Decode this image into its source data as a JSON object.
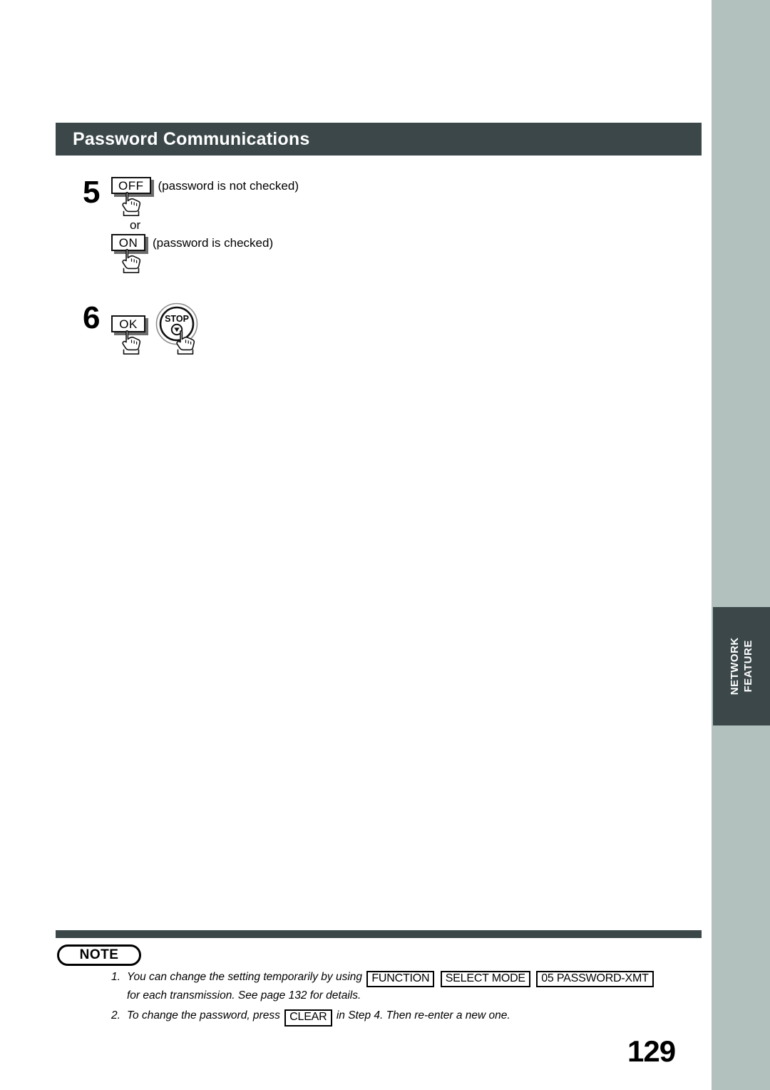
{
  "page": {
    "number": "129",
    "section_tab": "NETWORK\nFEATURE",
    "section_tab_line1": "NETWORK",
    "section_tab_line2": "FEATURE",
    "header_title": "Password Communications",
    "colors": {
      "header_bar": "#3b4749",
      "edge_band": "#b2c0be",
      "text": "#000000",
      "key_shadow": "#6d6d6d"
    }
  },
  "steps": [
    {
      "number": "5",
      "options": [
        {
          "key_label": "OFF",
          "key_icon": "hand-pointer-icon",
          "caption": "(password is not checked)"
        },
        {
          "separator": "or",
          "key_label": "ON",
          "key_icon": "hand-pointer-icon",
          "caption": "(password is checked)"
        }
      ]
    },
    {
      "number": "6",
      "keys": [
        {
          "key_label": "OK",
          "key_icon": "hand-pointer-icon",
          "shape": "rect"
        },
        {
          "key_label": "STOP",
          "key_icon": "hand-pointer-icon",
          "shape": "round"
        }
      ]
    }
  ],
  "note": {
    "badge": "NOTE",
    "items": [
      {
        "marker": "1.",
        "text_before": "You can change the setting temporarily by using",
        "keys": [
          "FUNCTION",
          "SELECT MODE",
          "05 PASSWORD-XMT"
        ],
        "text_after": "for each transmission. See page 132 for details."
      },
      {
        "marker": "2.",
        "text_before": "To change the password, press",
        "keys": [
          "CLEAR"
        ],
        "text_after": "in Step 4. Then re-enter a new one."
      }
    ]
  }
}
